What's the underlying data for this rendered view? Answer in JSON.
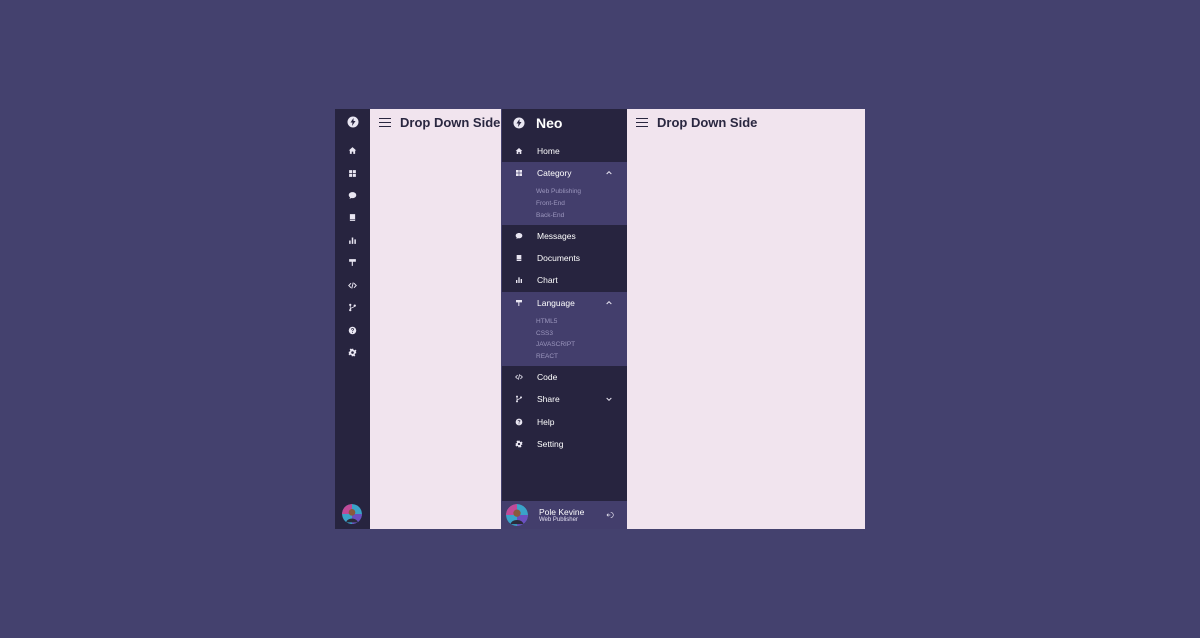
{
  "content": {
    "title": "Drop Down Side"
  },
  "brand": {
    "name": "Neo",
    "logo_icon": "bolt-icon"
  },
  "nav": {
    "home": "Home",
    "category": "Category",
    "category_sub": [
      "Web Publishing",
      "Front-End",
      "Back-End"
    ],
    "messages": "Messages",
    "documents": "Documents",
    "chart": "Chart",
    "language": "Language",
    "language_sub": [
      "HTML5",
      "CSS3",
      "JAVASCRIPT",
      "REACT"
    ],
    "code": "Code",
    "share": "Share",
    "help": "Help",
    "setting": "Setting"
  },
  "user": {
    "name": "Pole Kevine",
    "role": "Web Publisher"
  },
  "colors": {
    "background": "#44416e",
    "sidebar": "#27243f",
    "submenu": "#433e6c",
    "content": "#f1e4ee"
  }
}
